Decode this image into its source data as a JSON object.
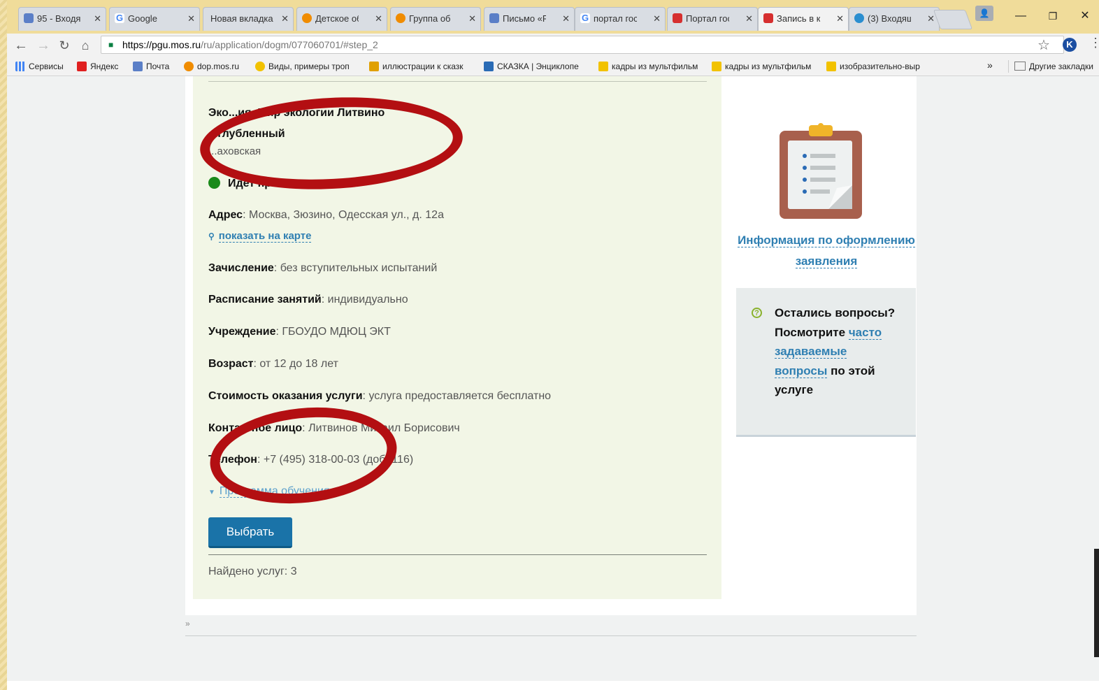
{
  "tabs": [
    {
      "title": "95 - Входящ",
      "color": "#5b7fc7"
    },
    {
      "title": "Google",
      "color": "#4285f4"
    },
    {
      "title": "Новая вкладка",
      "color": "#d9dde3"
    },
    {
      "title": "Детское об",
      "color": "#f08c00"
    },
    {
      "title": "Группа об",
      "color": "#f08c00"
    },
    {
      "title": "Письмо «F",
      "color": "#5b7fc7"
    },
    {
      "title": "портал гос",
      "color": "#4285f4"
    },
    {
      "title": "Портал гос",
      "color": "#d62f2f"
    },
    {
      "title": "Запись в к",
      "color": "#d62f2f"
    },
    {
      "title": "(3) Входящ",
      "color": "#2a8ed0"
    }
  ],
  "url": {
    "host": "https://pgu.mos.ru",
    "path": "/ru/application/dogm/077060701/#step_2"
  },
  "bookmarks": [
    {
      "label": "Сервисы",
      "color": "#4285f4"
    },
    {
      "label": "Яндекс",
      "color": "#e02020"
    },
    {
      "label": "Почта",
      "color": "#5b7fc7"
    },
    {
      "label": "dop.mos.ru",
      "color": "#f08c00"
    },
    {
      "label": "Виды, примеры троп",
      "color": "#f2c200"
    },
    {
      "label": "иллюстрации к сказк",
      "color": "#e0a000"
    },
    {
      "label": "СКАЗКА | Энциклопе",
      "color": "#2a6bb5"
    },
    {
      "label": "кадры из мультфильм",
      "color": "#f2c200"
    },
    {
      "label": "кадры из мультфильм",
      "color": "#f2c200"
    },
    {
      "label": "изобразительно-выр",
      "color": "#f2c200"
    }
  ],
  "bookmarks_more": "»",
  "bookmarks_other": "Другие закладки",
  "service": {
    "name_line1": "Эко...ия, Мир экологии Литвино",
    "name_line2": "...глубленный",
    "metro": "...аховская",
    "status": "Идет прием",
    "address_label": "Адрес",
    "address": ": Москва, Зюзино, Одесская ул., д. 12а",
    "map_link": "показать на карте",
    "enroll_label": "Зачисление",
    "enroll": ": без вступительных испытаний",
    "schedule_label": "Расписание занятий",
    "schedule": ": индивидуально",
    "institution_label": "Учреждение",
    "institution": ": ГБОУДО МДЮЦ ЭКТ",
    "age_label": "Возраст",
    "age": ": от 12 до 18 лет",
    "cost_label": "Стоимость оказания услуги",
    "cost": ": услуга предоставляется бесплатно",
    "contact_label": "Контактное лицо",
    "contact": ": Литвинов Михаил Борисович",
    "phone_label": "Телефон",
    "phone": ": +7 (495) 318-00-03 (доб. 116)",
    "programs_link": "Программа обучения",
    "choose_button": "Выбрать",
    "found": "Найдено услуг: 3"
  },
  "sidebar": {
    "info_link": "Информация по оформлению заявления",
    "faq_text_before": "Остались вопросы? Посмотрите ",
    "faq_link": "часто задаваемые вопросы",
    "faq_text_after": " по этой услуге"
  },
  "breadcrumb": "»"
}
